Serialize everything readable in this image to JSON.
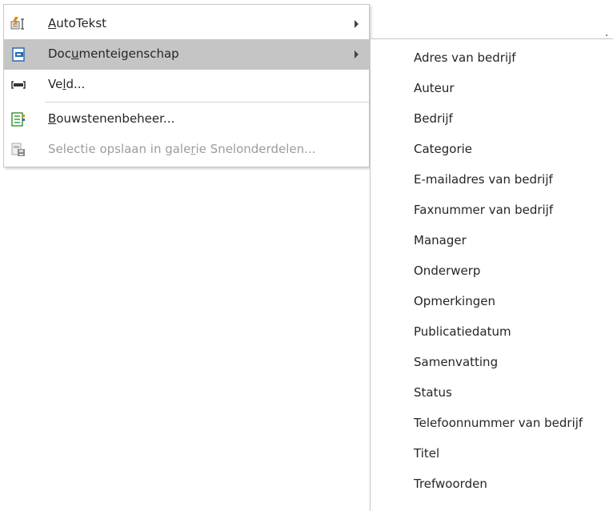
{
  "menu": {
    "items": [
      {
        "prefix": "",
        "mnemonic": "A",
        "suffix": "utoTekst",
        "icon": "autotext-icon",
        "submenu": true,
        "selected": false,
        "disabled": false
      },
      {
        "prefix": "Doc",
        "mnemonic": "u",
        "suffix": "menteigenschap",
        "icon": "document-property-icon",
        "submenu": true,
        "selected": true,
        "disabled": false
      },
      {
        "prefix": "Ve",
        "mnemonic": "l",
        "suffix": "d...",
        "icon": "field-icon",
        "submenu": false,
        "selected": false,
        "disabled": false
      },
      {
        "prefix": "",
        "mnemonic": "B",
        "suffix": "ouwstenenbeheer...",
        "icon": "building-blocks-organizer-icon",
        "submenu": false,
        "selected": false,
        "disabled": false
      },
      {
        "prefix": "Selectie opslaan in gale",
        "mnemonic": "r",
        "suffix": "ie Snelonderdelen...",
        "icon": "save-selection-gallery-icon",
        "submenu": false,
        "selected": false,
        "disabled": true
      }
    ]
  },
  "submenu": {
    "items": [
      "Adres van bedrijf",
      "Auteur",
      "Bedrijf",
      "Categorie",
      "E-mailadres van bedrijf",
      "Faxnummer van bedrijf",
      "Manager",
      "Onderwerp",
      "Opmerkingen",
      "Publicatiedatum",
      "Samenvatting",
      "Status",
      "Telefoonnummer van bedrijf",
      "Titel",
      "Trefwoorden"
    ]
  },
  "colors": {
    "selected_bg": "#c5c5c5",
    "disabled_text": "#9c9c9c",
    "text": "#262626",
    "icon_blue": "#2b6cb0",
    "icon_green": "#3a9a3a",
    "icon_orange": "#e08b00"
  }
}
